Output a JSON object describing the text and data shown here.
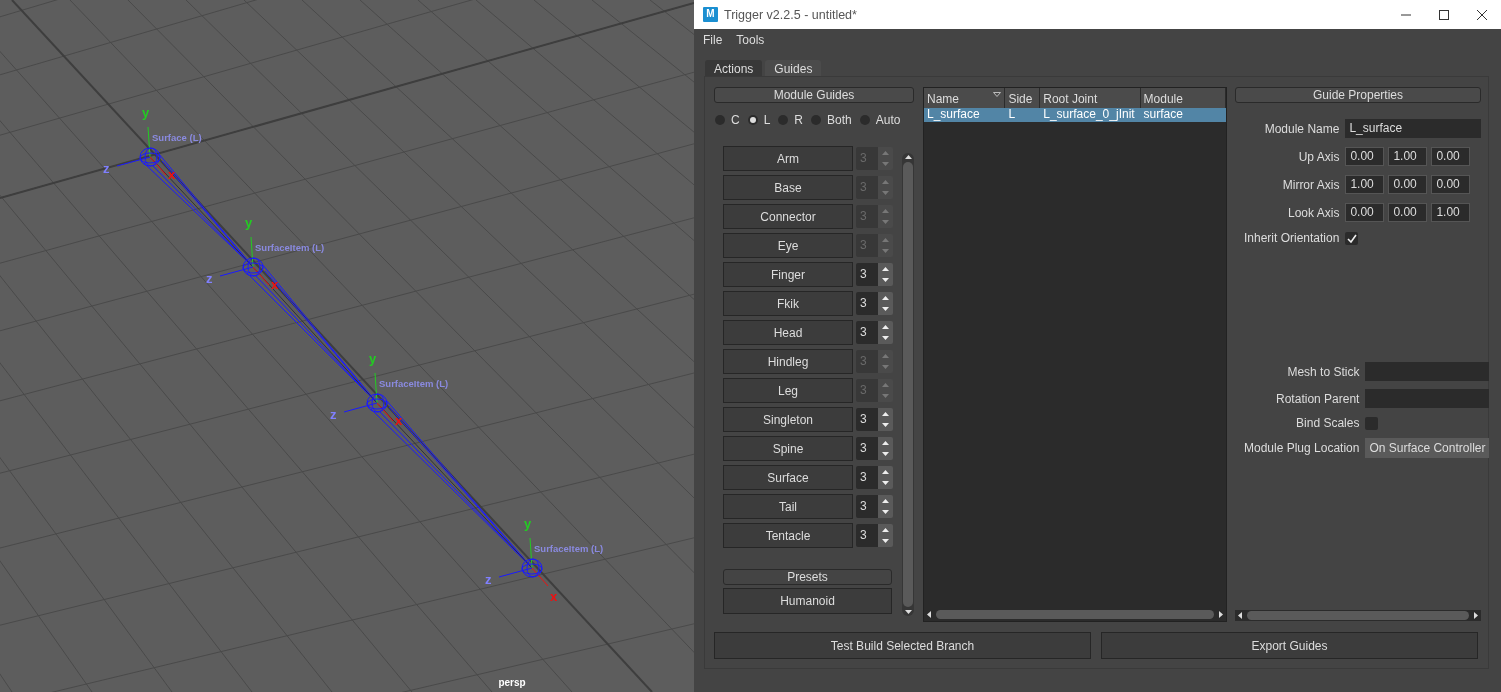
{
  "viewport": {
    "camera": "persp",
    "joints": [
      {
        "label": "Surface (L)",
        "axes": [
          "y",
          "z",
          "x"
        ]
      },
      {
        "label": "SurfaceItem (L)",
        "axes": [
          "y",
          "z",
          "x"
        ]
      },
      {
        "label": "SurfaceItem (L)",
        "axes": [
          "y",
          "z",
          "x"
        ]
      },
      {
        "label": "SurfaceItem (L)",
        "axes": [
          "y",
          "z",
          "x"
        ]
      }
    ]
  },
  "window": {
    "icon_text": "M",
    "title": "Trigger v2.2.5 - untitled*"
  },
  "menu": [
    "File",
    "Tools"
  ],
  "tabs": [
    {
      "label": "Actions",
      "selected": false
    },
    {
      "label": "Guides",
      "selected": true
    }
  ],
  "module_guides": {
    "title": "Module Guides",
    "sides": [
      {
        "label": "C",
        "selected": false
      },
      {
        "label": "L",
        "selected": true
      },
      {
        "label": "R",
        "selected": false
      },
      {
        "label": "Both",
        "selected": false
      },
      {
        "label": "Auto",
        "selected": false
      }
    ],
    "modules": [
      {
        "name": "Arm",
        "count": "3",
        "disabled": true
      },
      {
        "name": "Base",
        "count": "3",
        "disabled": true
      },
      {
        "name": "Connector",
        "count": "3",
        "disabled": true
      },
      {
        "name": "Eye",
        "count": "3",
        "disabled": true
      },
      {
        "name": "Finger",
        "count": "3",
        "disabled": false
      },
      {
        "name": "Fkik",
        "count": "3",
        "disabled": false
      },
      {
        "name": "Head",
        "count": "3",
        "disabled": false
      },
      {
        "name": "Hindleg",
        "count": "3",
        "disabled": true
      },
      {
        "name": "Leg",
        "count": "3",
        "disabled": true
      },
      {
        "name": "Singleton",
        "count": "3",
        "disabled": false
      },
      {
        "name": "Spine",
        "count": "3",
        "disabled": false
      },
      {
        "name": "Surface",
        "count": "3",
        "disabled": false
      },
      {
        "name": "Tail",
        "count": "3",
        "disabled": false
      },
      {
        "name": "Tentacle",
        "count": "3",
        "disabled": false
      }
    ],
    "presets": {
      "title": "Presets",
      "items": [
        "Humanoid"
      ]
    }
  },
  "guides_table": {
    "columns": [
      {
        "label": "Name",
        "sorted": true
      },
      {
        "label": "Side",
        "sorted": false
      },
      {
        "label": "Root Joint",
        "sorted": false
      },
      {
        "label": "Module",
        "sorted": false
      }
    ],
    "rows": [
      {
        "cells": [
          "L_surface",
          "L",
          "L_surface_0_jInit",
          "surface"
        ],
        "selected": true
      }
    ]
  },
  "guide_properties": {
    "title": "Guide Properties",
    "upper_fields": [
      {
        "kind": "text",
        "label": "Module Name",
        "value": "L_surface"
      },
      {
        "kind": "vector",
        "label": "Up Axis",
        "values": [
          "0.00",
          "1.00",
          "0.00"
        ]
      },
      {
        "kind": "vector",
        "label": "Mirror Axis",
        "values": [
          "1.00",
          "0.00",
          "0.00"
        ]
      },
      {
        "kind": "vector",
        "label": "Look Axis",
        "values": [
          "0.00",
          "0.00",
          "1.00"
        ]
      },
      {
        "kind": "checkbox",
        "label": "Inherit Orientation",
        "checked": true
      }
    ],
    "lower_fields": [
      {
        "kind": "text",
        "label": "Mesh to Stick"
      },
      {
        "kind": "text",
        "label": "Rotation Parent"
      },
      {
        "kind": "checkbox",
        "label": "Bind Scales",
        "checked": false
      },
      {
        "kind": "button",
        "label": "Module Plug Location",
        "value": "On Surface Controller"
      }
    ]
  },
  "buttons": [
    "Test Build Selected Branch",
    "Export Guides"
  ]
}
